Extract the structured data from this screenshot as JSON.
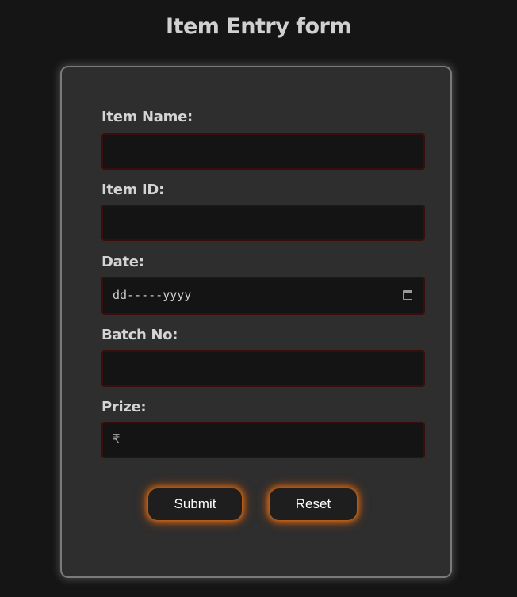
{
  "page": {
    "title": "Item Entry form"
  },
  "form": {
    "fields": [
      {
        "label": "Item Name:",
        "value": ""
      },
      {
        "label": "Item ID:",
        "value": ""
      },
      {
        "label": "Date:",
        "placeholder": "dd-----yyyy"
      },
      {
        "label": "Batch No:",
        "value": ""
      },
      {
        "label": "Prize:",
        "prefix": "₹",
        "value": ""
      }
    ],
    "submit_label": "Submit",
    "reset_label": "Reset"
  },
  "colors": {
    "background": "#151515",
    "card": "#2e2e2e",
    "input_bg": "#141414",
    "button_glow": "#ff7a0a"
  },
  "icons": {
    "date_picker": "calendar-icon"
  }
}
